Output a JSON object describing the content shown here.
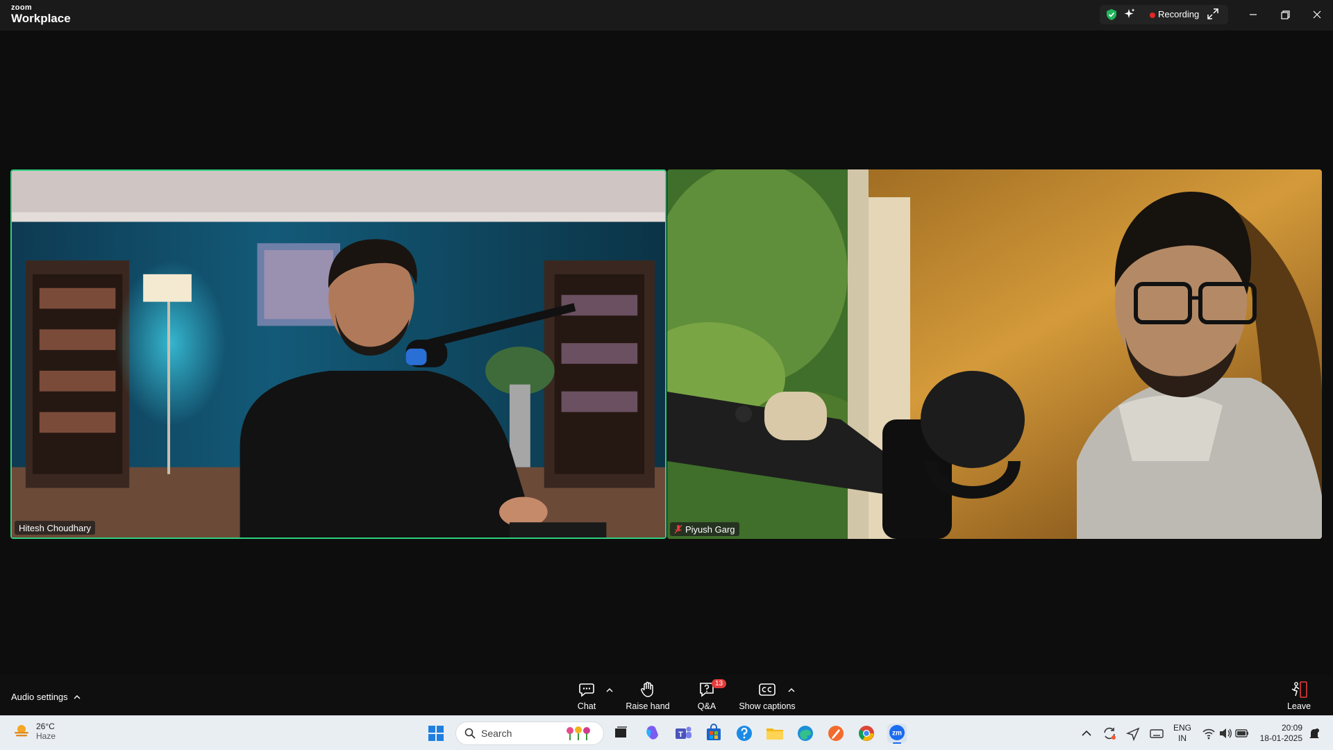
{
  "app": {
    "brand_small": "zoom",
    "brand_big": "Workplace",
    "recording_label": "Recording"
  },
  "participants": [
    {
      "name": "Hitesh Choudhary",
      "active_speaker": true,
      "muted": false
    },
    {
      "name": "Piyush Garg",
      "active_speaker": false,
      "muted": true
    }
  ],
  "toolbar": {
    "audio_settings": "Audio settings",
    "chat": "Chat",
    "raise_hand": "Raise hand",
    "qa": "Q&A",
    "qa_badge": "13",
    "captions": "Show captions",
    "leave": "Leave"
  },
  "taskbar": {
    "weather_temp": "26°C",
    "weather_cond": "Haze",
    "search_placeholder": "Search",
    "lang_top": "ENG",
    "lang_bottom": "IN",
    "time": "20:09",
    "date": "18-01-2025"
  },
  "colors": {
    "active_border": "#2fd17e",
    "recording_dot": "#e02828",
    "badge": "#e63b3b"
  }
}
